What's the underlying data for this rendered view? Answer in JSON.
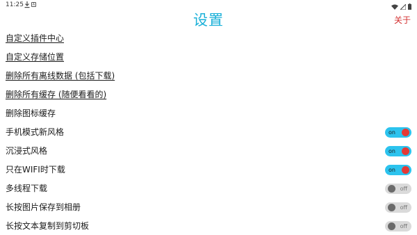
{
  "status_bar": {
    "time": "11:25",
    "download_icon": "download-icon",
    "a_icon": "A",
    "right_icons": [
      "wifi-icon",
      "signal-icon",
      "battery-icon"
    ]
  },
  "header": {
    "title": "设置",
    "about_label": "关于"
  },
  "rows": [
    {
      "label": "自定义插件中心",
      "type": "link"
    },
    {
      "label": "自定义存储位置",
      "type": "link"
    },
    {
      "label": "删除所有离线数据 (包括下载)",
      "type": "link"
    },
    {
      "label": "删除所有缓存 (随便看看的)",
      "type": "link"
    },
    {
      "label": "删除图标缓存",
      "type": "text"
    },
    {
      "label": "手机模式新风格",
      "type": "toggle",
      "state": "on",
      "toggle_text": "on"
    },
    {
      "label": "沉浸式风格",
      "type": "toggle",
      "state": "on",
      "toggle_text": "on"
    },
    {
      "label": "只在WIFI时下载",
      "type": "toggle",
      "state": "on",
      "toggle_text": "on"
    },
    {
      "label": "多线程下载",
      "type": "toggle",
      "state": "off",
      "toggle_text": "off"
    },
    {
      "label": "长按图片保存到相册",
      "type": "toggle",
      "state": "off",
      "toggle_text": "off"
    },
    {
      "label": "长按文本复制到剪切板",
      "type": "toggle",
      "state": "off",
      "toggle_text": "off"
    }
  ],
  "colors": {
    "title": "#1ab0d8",
    "about": "#d32f2f",
    "toggle_on_track": "#2cc3ee",
    "toggle_on_knob": "#e53935",
    "toggle_off_track": "#dadada",
    "toggle_off_knob": "#6b6b6b"
  }
}
